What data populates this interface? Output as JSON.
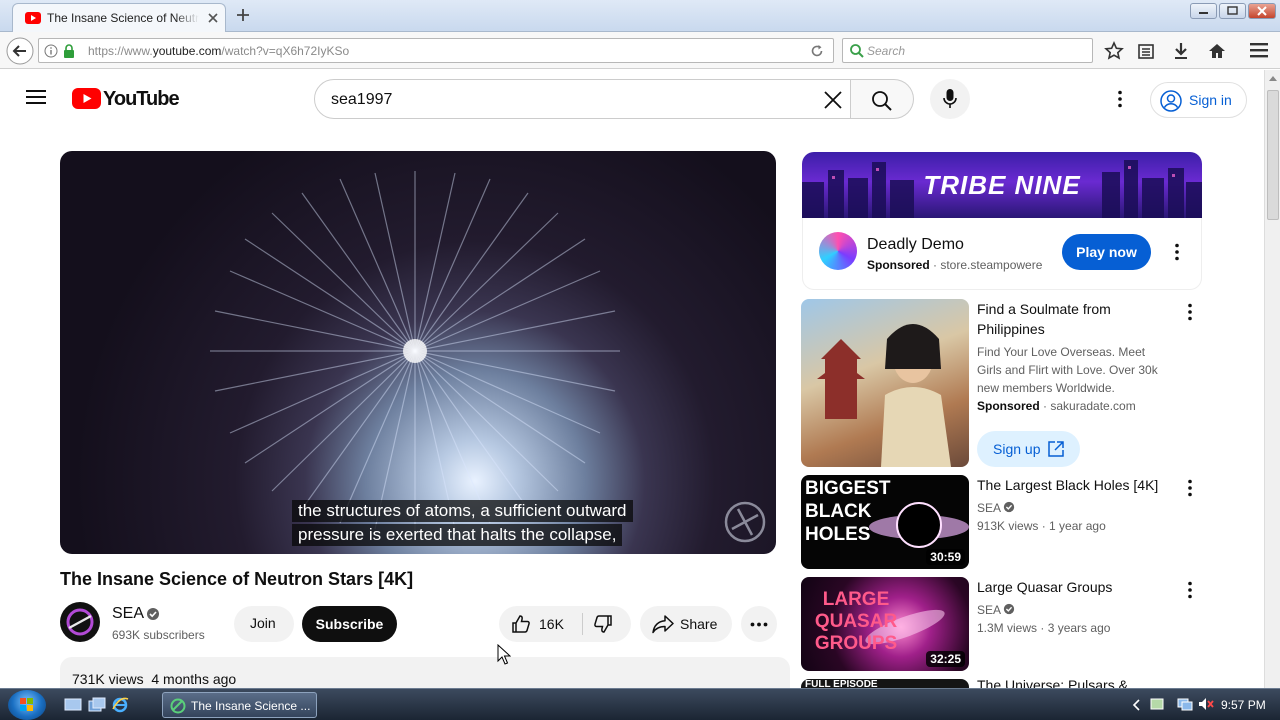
{
  "browser": {
    "tab_title": "The Insane Science of Neutr",
    "url_prefix": "https://www.",
    "url_domain": "youtube.com",
    "url_path": "/watch?v=qX6h72IyKSo",
    "search_placeholder": "Search"
  },
  "youtube": {
    "logo_text": "YouTube",
    "search_query": "sea1997",
    "sign_in_label": "Sign in"
  },
  "player": {
    "caption_line1": "the structures of atoms, a sufficient outward",
    "caption_line2": "pressure is exerted that halts the collapse,"
  },
  "video": {
    "title": "The Insane Science of Neutron Stars [4K]",
    "channel": "SEA",
    "subscribers": "693K subscribers",
    "join_label": "Join",
    "subscribe_label": "Subscribe",
    "likes": "16K",
    "share_label": "Share",
    "views": "731K views",
    "age": "4 months ago"
  },
  "ad": {
    "banner_text": "TRIBE NINE",
    "title": "Deadly Demo",
    "sponsored": "Sponsored",
    "domain": "store.steampowere",
    "cta": "Play now"
  },
  "recommendations": [
    {
      "title": "Find a Soulmate from Philippines",
      "description": "Find Your Love Overseas. Meet Girls and Flirt with Love. Over 30k new members Worldwide.",
      "sponsored": "Sponsored",
      "domain": "sakuradate.com",
      "cta": "Sign up"
    },
    {
      "title": "The Largest Black Holes [4K]",
      "thumb_text": "BIGGEST BLACK HOLES",
      "duration": "30:59",
      "channel": "SEA",
      "views": "913K views",
      "age": "1 year ago"
    },
    {
      "title": "Large Quasar Groups",
      "thumb_text": "LARGE QUASAR GROUPS",
      "duration": "32:25",
      "channel": "SEA",
      "views": "1.3M views",
      "age": "3 years ago"
    },
    {
      "title": "The Universe: Pulsars &",
      "thumb_text": "FULL EPISODE"
    }
  ],
  "taskbar": {
    "task_label": "The Insane Science ...",
    "clock": "9:57 PM"
  },
  "colors": {
    "youtube_red": "#ff0000",
    "link_blue": "#065fd4",
    "text_primary": "#0f0f0f",
    "text_secondary": "#606060"
  }
}
